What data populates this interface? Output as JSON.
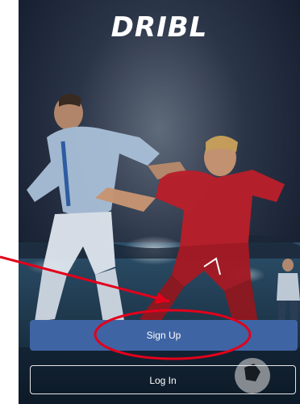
{
  "app": {
    "logo_text": "DRIBL"
  },
  "actions": {
    "signup_label": "Sign Up",
    "login_label": "Log In"
  },
  "colors": {
    "signup_button": "#3f64a4",
    "annotation": "#e3001b"
  },
  "icons": {
    "background": "soccer-players-stadium-photo"
  }
}
